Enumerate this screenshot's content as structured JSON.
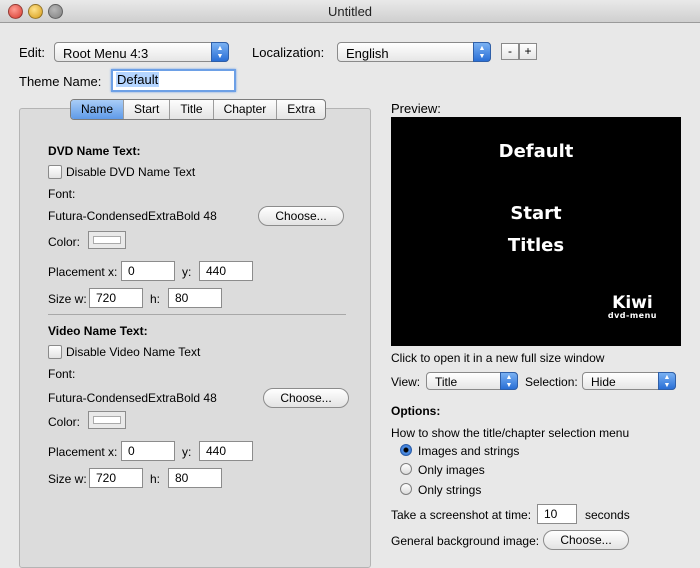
{
  "window": {
    "title": "Untitled"
  },
  "top": {
    "edit_label": "Edit:",
    "edit_value": "Root Menu 4:3",
    "localization_label": "Localization:",
    "localization_value": "English",
    "minus": "-",
    "plus": "+",
    "theme_label": "Theme Name:",
    "theme_value": "Default"
  },
  "tabs": [
    {
      "label": "Name",
      "active": true
    },
    {
      "label": "Start"
    },
    {
      "label": "Title"
    },
    {
      "label": "Chapter"
    },
    {
      "label": "Extra"
    }
  ],
  "dvd": {
    "heading": "DVD Name Text:",
    "disable_label": "Disable DVD Name Text",
    "font_label": "Font:",
    "font_value": "Futura-CondensedExtraBold 48",
    "choose": "Choose...",
    "color_label": "Color:",
    "placement_label": "Placement x:",
    "x": "0",
    "y_label": "y:",
    "y": "440",
    "size_label": "Size w:",
    "w": "720",
    "h_label": "h:",
    "h": "80"
  },
  "video": {
    "heading": "Video Name Text:",
    "disable_label": "Disable Video Name Text",
    "font_label": "Font:",
    "font_value": "Futura-CondensedExtraBold 48",
    "choose": "Choose...",
    "color_label": "Color:",
    "placement_label": "Placement x:",
    "x": "0",
    "y_label": "y:",
    "y": "440",
    "size_label": "Size w:",
    "w": "720",
    "h_label": "h:",
    "h": "80"
  },
  "preview": {
    "label": "Preview:",
    "title": "Default",
    "line1": "Start",
    "line2": "Titles",
    "logo": "Kiwi",
    "logo_sub": "dvd-menu",
    "hint": "Click to open it in a new full size window"
  },
  "view": {
    "view_label": "View:",
    "view_value": "Title",
    "selection_label": "Selection:",
    "selection_value": "Hide"
  },
  "options": {
    "heading": "Options:",
    "question": "How to show the title/chapter selection menu",
    "radios": [
      {
        "label": "Images and strings",
        "selected": true
      },
      {
        "label": "Only images",
        "selected": false
      },
      {
        "label": "Only strings",
        "selected": false
      }
    ],
    "screenshot_label": "Take a screenshot at time:",
    "screenshot_value": "10",
    "seconds": "seconds",
    "bg_label": "General background image:",
    "bg_button": "Choose..."
  }
}
